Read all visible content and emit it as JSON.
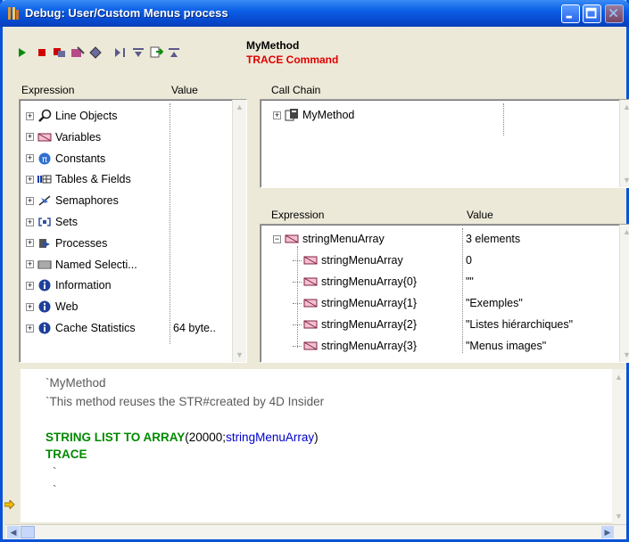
{
  "window": {
    "title": "Debug: User/Custom Menus process"
  },
  "method": {
    "name": "MyMethod",
    "command": "TRACE Command"
  },
  "toolbar_icons": [
    "run-icon",
    "stop-icon",
    "abort-icon",
    "edit-icon",
    "trace-icon",
    "step-over-icon",
    "step-into-icon",
    "step-out-icon",
    "step-down-icon"
  ],
  "left_panel": {
    "col_expression": "Expression",
    "col_value": "Value",
    "items": [
      {
        "label": "Line Objects",
        "value": "",
        "icon": "magnifier-icon"
      },
      {
        "label": "Variables",
        "value": "",
        "icon": "variables-icon"
      },
      {
        "label": "Constants",
        "value": "",
        "icon": "pi-icon"
      },
      {
        "label": "Tables & Fields",
        "value": "",
        "icon": "table-icon"
      },
      {
        "label": "Semaphores",
        "value": "",
        "icon": "semaphore-icon"
      },
      {
        "label": "Sets",
        "value": "",
        "icon": "set-icon"
      },
      {
        "label": "Processes",
        "value": "",
        "icon": "process-icon"
      },
      {
        "label": "Named Selecti...",
        "value": "",
        "icon": "selection-icon"
      },
      {
        "label": "Information",
        "value": "",
        "icon": "info-icon"
      },
      {
        "label": "Web",
        "value": "",
        "icon": "info-icon"
      },
      {
        "label": "Cache Statistics",
        "value": "64 byte..",
        "icon": "info-icon"
      }
    ]
  },
  "call_chain": {
    "header": "Call Chain",
    "items": [
      {
        "label": "MyMethod"
      }
    ]
  },
  "watch": {
    "col_expression": "Expression",
    "col_value": "Value",
    "root": {
      "label": "stringMenuArray",
      "value": "3 elements"
    },
    "children": [
      {
        "label": "stringMenuArray",
        "value": "0"
      },
      {
        "label": "stringMenuArray{0}",
        "value": "\"\""
      },
      {
        "label": "stringMenuArray{1}",
        "value": "\"Exemples\""
      },
      {
        "label": "stringMenuArray{2}",
        "value": "\"Listes hiérarchiques\""
      },
      {
        "label": "stringMenuArray{3}",
        "value": "\"Menus images\""
      }
    ]
  },
  "code": {
    "comment1": "`MyMethod",
    "comment2": "`This method reuses the STR#created by 4D Insider",
    "line3_cmd": "STRING LIST TO ARRAY",
    "line3_open": "(20000;",
    "line3_var": "stringMenuArray",
    "line3_close": ")",
    "line4": "TRACE",
    "line5": "`",
    "line6": "`"
  },
  "colors": {
    "title_bar": "#0a5fe6",
    "command_green": "#008a00",
    "trace_red": "#e00000",
    "variable_blue": "#0000cc"
  }
}
